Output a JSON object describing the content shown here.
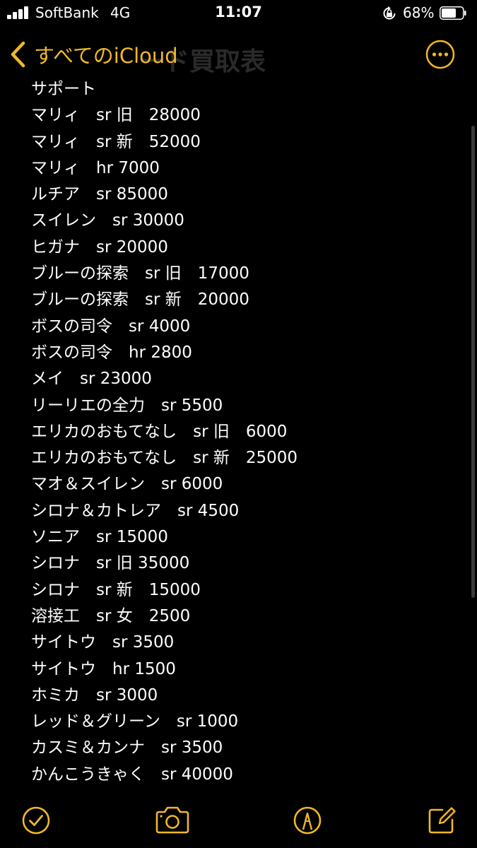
{
  "status_bar": {
    "carrier": "SoftBank",
    "network": "4G",
    "time": "11:07",
    "battery": "68%",
    "icons": [
      "signal-icon",
      "orientation-lock-icon",
      "battery-icon"
    ]
  },
  "nav": {
    "back_label": "すべてのiCloud",
    "ghost_title": "ード買取表",
    "accent_color": "#f0b827",
    "icons": [
      "chevron-left-icon",
      "more-icon"
    ]
  },
  "note": {
    "lines": [
      "サポート",
      "マリィ　sr 旧　28000",
      "マリィ　sr 新　52000",
      "マリィ　hr 7000",
      "ルチア　sr  85000",
      "スイレン　sr 30000",
      "ヒガナ　sr 20000",
      "ブルーの探索　sr 旧　17000",
      "ブルーの探索　sr 新　20000",
      "ボスの司令　sr 4000",
      "ボスの司令　hr 2800",
      "メイ　sr 23000",
      "リーリエの全力　sr 5500",
      "エリカのおもてなし　sr 旧　6000",
      "エリカのおもてなし　sr 新　25000",
      "マオ＆スイレン　sr 6000",
      "シロナ＆カトレア　sr 4500",
      "ソニア　sr 15000",
      "シロナ　sr 旧 35000",
      "シロナ　sr 新　15000",
      "溶接工　sr 女　2500",
      "サイトウ　sr 3500",
      "サイトウ　hr 1500",
      "ホミカ　sr 3000",
      "レッド＆グリーン　sr 1000",
      "カスミ＆カンナ　sr 3500",
      "かんこうきゃく　sr 40000"
    ]
  },
  "toolbar": {
    "icons": [
      "checklist-icon",
      "camera-icon",
      "markup-icon",
      "compose-icon"
    ]
  }
}
